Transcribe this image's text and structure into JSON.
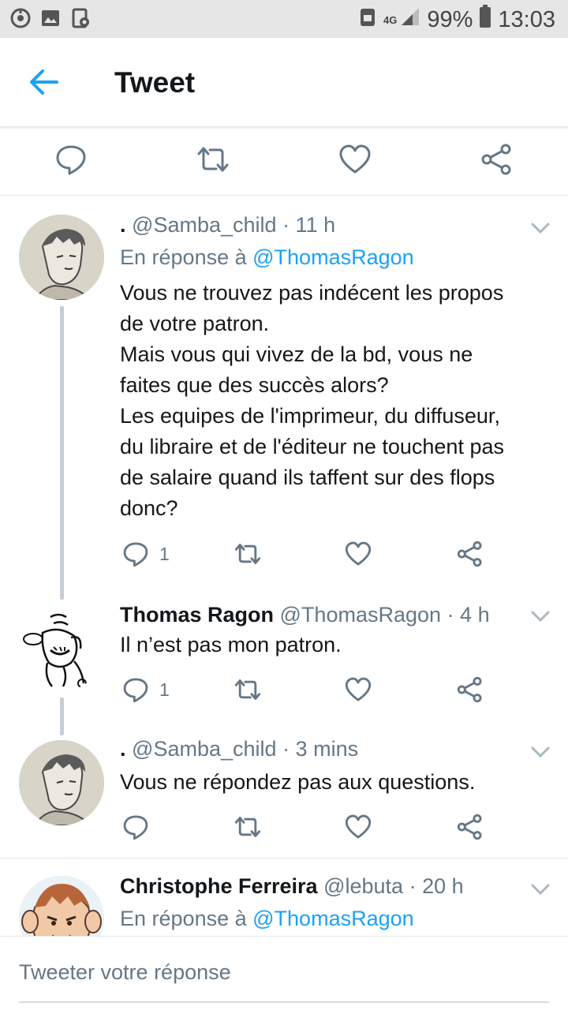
{
  "status_bar": {
    "network": "4G",
    "battery": "99%",
    "time": "13:03",
    "left_icons": [
      "sync-icon",
      "image-icon",
      "screenshot-icon"
    ],
    "right_icons": [
      "storage-icon",
      "signal-icon",
      "battery-icon"
    ]
  },
  "header": {
    "title": "Tweet",
    "back_icon": "back-arrow-icon"
  },
  "main_actions": [
    "reply-icon",
    "retweet-icon",
    "like-icon",
    "share-icon"
  ],
  "tweets": [
    {
      "name": ".",
      "handle": "@Samba_child",
      "time": "· 11 h",
      "reply_prefix": "En réponse à",
      "reply_to": "@ThomasRagon",
      "lines": [
        "Vous ne trouvez pas indécent les propos",
        "de votre patron.",
        "Mais vous qui vivez de la bd, vous ne",
        "faites que des succès alors?",
        "Les equipes de l'imprimeur, du diffuseur,",
        "du libraire et de l'éditeur ne touchent pas",
        "de salaire quand ils taffent sur des flops",
        "donc?"
      ],
      "reply_count": "1"
    },
    {
      "name": "Thomas Ragon",
      "handle": "@ThomasRagon",
      "time": "· 4 h",
      "text": "Il n’est pas mon patron.",
      "reply_count": "1"
    },
    {
      "name": ".",
      "handle": "@Samba_child",
      "time": "· 3 mins",
      "text": "Vous ne répondez pas aux questions."
    },
    {
      "name": "Christophe Ferreira",
      "handle": "@lebuta",
      "time": "· 20 h",
      "reply_prefix": "En réponse à",
      "reply_to": "@ThomasRagon"
    }
  ],
  "composer": {
    "placeholder": "Tweeter votre réponse"
  },
  "colors": {
    "accent": "#1da1f2",
    "text": "#14171a",
    "secondary": "#657786",
    "thread": "#c4ced6",
    "statusbar": "#e6e6e6"
  }
}
